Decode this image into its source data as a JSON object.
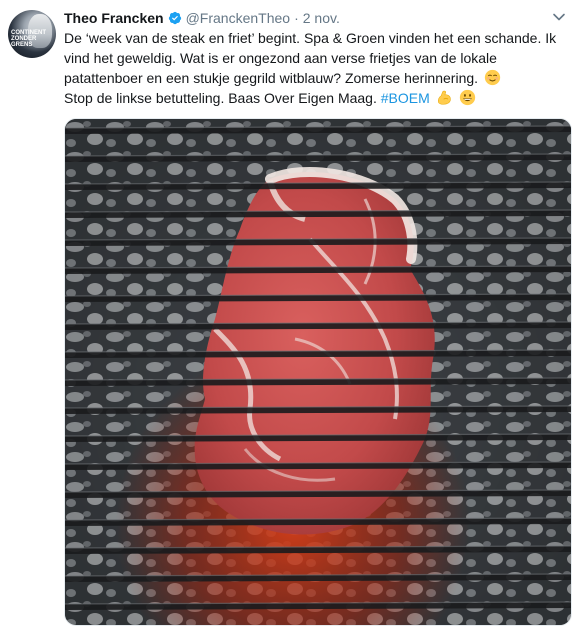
{
  "tweet": {
    "author_name": "Theo Francken",
    "handle": "@FranckenTheo",
    "separator": "·",
    "date": "2 nov.",
    "avatar_text": "CONTINENT ZONDER GRENS",
    "text_line1": "De ‘week van de steak en friet’ begint. Spa & Groen vinden het een schande. Ik vind het geweldig. Wat is er ongezond aan verse frietjes van de lokale patattenboer en een stukje gegrild witblauw? Zomerse herinnering.",
    "text_line2": "Stop de linkse betutteling. Baas Over Eigen Maag.",
    "hashtag": "#BOEM",
    "icons": {
      "verified": "verified-badge-icon",
      "chevron": "chevron-down-icon",
      "emoji1": "relieved-face-emoji",
      "emoji2": "flexed-biceps-emoji",
      "emoji3": "grinning-face-emoji"
    },
    "colors": {
      "link": "#1b95e0",
      "secondary_text": "#657786",
      "primary_text": "#14171a",
      "verified": "#1da1f2"
    },
    "image": {
      "description_icon": "steak-on-grill-photo"
    }
  }
}
